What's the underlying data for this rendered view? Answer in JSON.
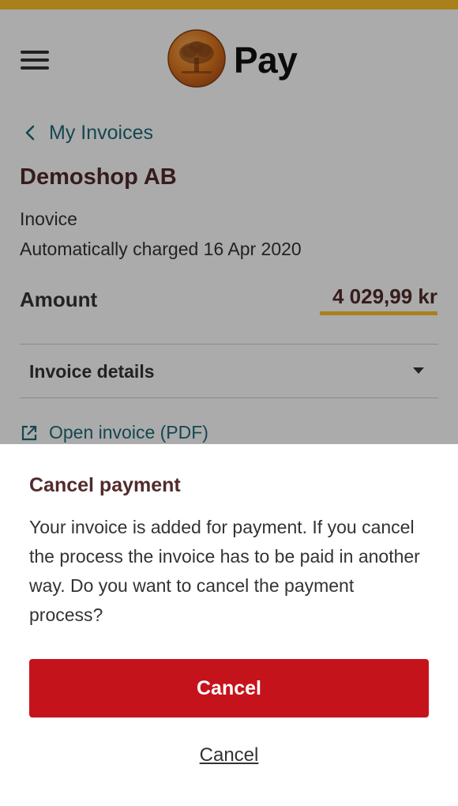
{
  "app": {
    "name": "Pay"
  },
  "nav": {
    "back_label": "My Invoices"
  },
  "invoice": {
    "merchant": "Demoshop AB",
    "type": "Inovice",
    "status": "Automatically charged 16 Apr 2020",
    "amount_label": "Amount",
    "amount": "4 029,99 kr",
    "details_label": "Invoice details",
    "pdf_link": "Open invoice (PDF)"
  },
  "dialog": {
    "title": "Cancel payment",
    "message": "Your invoice is added for payment. If you cancel the process the invoice has to be paid in another way. Do you want to cancel the payment process?",
    "confirm_label": "Cancel",
    "dismiss_label": "Cancel"
  },
  "colors": {
    "accent": "#FDC129",
    "primary_button": "#C5131C",
    "link": "#1F6A78",
    "heading": "#512B2B"
  },
  "icons": {
    "menu": "menu-icon",
    "logo": "oak-tree-logo",
    "back": "chevron-left-icon",
    "expand": "caret-down-icon",
    "external": "external-link-icon"
  }
}
